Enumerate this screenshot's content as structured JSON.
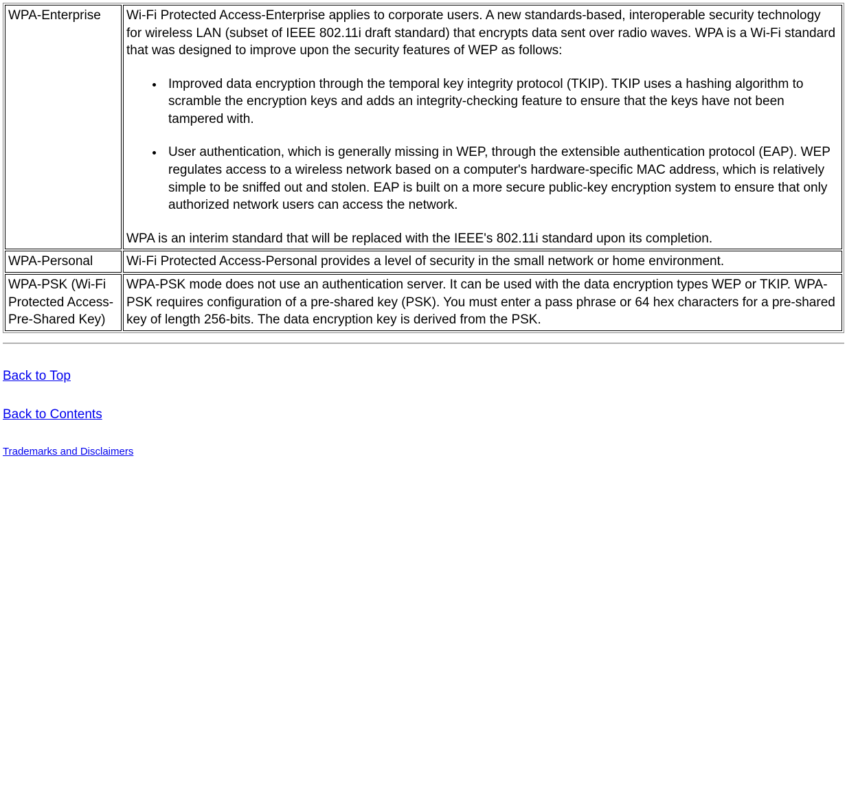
{
  "rows": [
    {
      "term": "WPA-Enterprise",
      "intro": "Wi-Fi Protected Access-Enterprise applies to corporate users. A new standards-based, interoperable security technology for wireless LAN (subset of IEEE 802.11i draft standard) that encrypts data sent over radio waves. WPA is a Wi-Fi standard that was designed to improve upon the security features of WEP as follows:",
      "bullets": [
        "Improved data encryption through the temporal key integrity protocol (TKIP). TKIP uses a hashing algorithm to scramble the encryption keys and adds an integrity-checking feature to ensure that the keys have not been tampered with.",
        "User authentication, which is generally missing in WEP, through the extensible authentication protocol (EAP). WEP regulates access to a wireless network based on a computer's hardware-specific MAC address, which is relatively simple to be sniffed out and stolen. EAP is built on a more secure public-key encryption system to ensure that only authorized network users can access the network."
      ],
      "outro": "WPA is an interim standard that will be replaced with the IEEE's 802.11i standard upon its completion."
    },
    {
      "term": "WPA-Personal",
      "description": "Wi-Fi Protected Access-Personal provides a level of security in the small network or home environment."
    },
    {
      "term": "WPA-PSK (Wi-Fi Protected Access-Pre-Shared Key)",
      "description": "WPA-PSK mode does not use an authentication server. It can be used with the data encryption types WEP or TKIP. WPA-PSK requires configuration of a pre-shared key (PSK). You must enter a pass phrase or 64 hex characters for a pre-shared key of length 256-bits. The data encryption key is derived from the PSK."
    }
  ],
  "links": {
    "back_to_top": "Back to Top",
    "back_to_contents": "Back to Contents",
    "trademarks": "Trademarks and Disclaimers"
  }
}
